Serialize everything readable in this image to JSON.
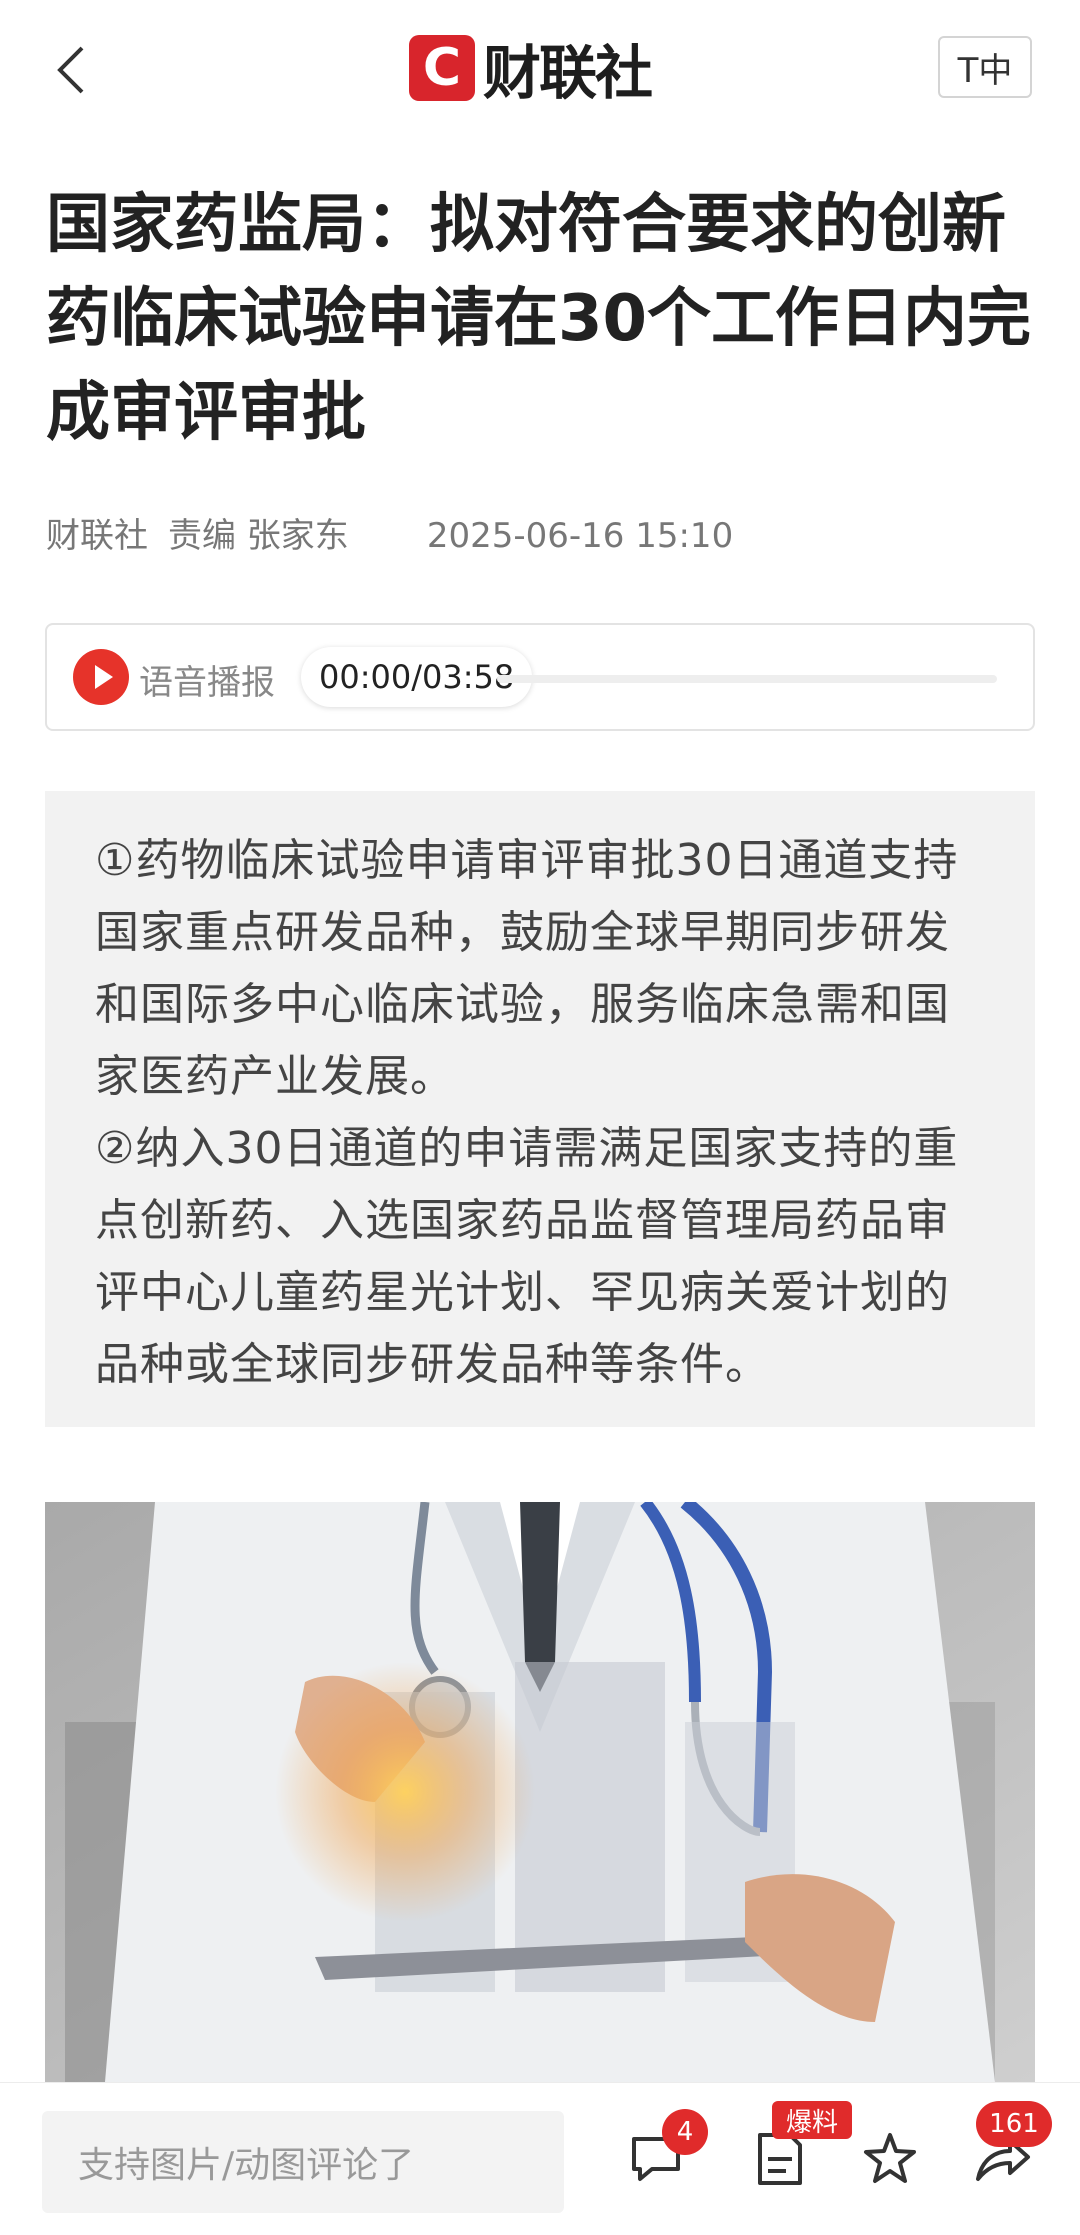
{
  "header": {
    "logo_letter": "C",
    "logo_text": "财联社",
    "font_size_button": "T中"
  },
  "article": {
    "title": "国家药监局：拟对符合要求的创新药临床试验申请在30个工作日内完成审评审批",
    "source": "财联社",
    "editor": "责编 张家东",
    "datetime": "2025-06-16 15:10"
  },
  "audio": {
    "label": "语音播报",
    "time": "00:00/03:58",
    "progress": 0
  },
  "summary": {
    "p1": "①药物临床试验申请审评审批30日通道支持国家重点研发品种，鼓励全球早期同步研发和国际多中心临床试验，服务临床急需和国家医药产业发展。",
    "p2": "②纳入30日通道的申请需满足国家支持的重点创新药、入选国家药品监督管理局药品审评中心儿童药星光计划、罕见病关爱计划的品种或全球同步研发品种等条件。"
  },
  "bottom_bar": {
    "comment_placeholder": "支持图片/动图评论了",
    "comment_count": "4",
    "report_label": "爆料",
    "share_count": "161"
  },
  "colors": {
    "brand_red": "#d8252c",
    "badge_red": "#e02b2b"
  }
}
